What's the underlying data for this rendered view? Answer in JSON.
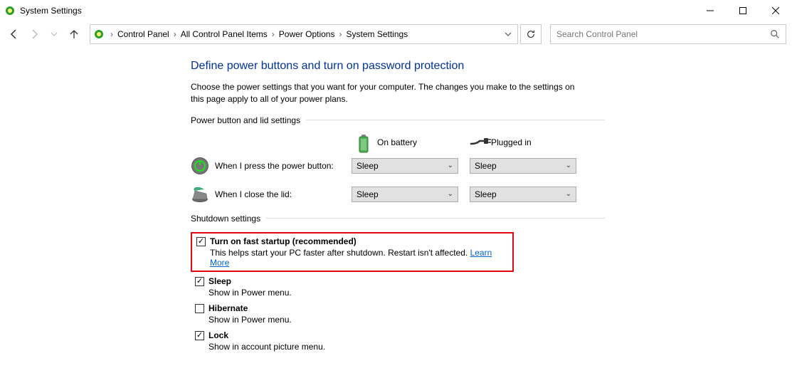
{
  "titlebar": {
    "title": "System Settings"
  },
  "breadcrumb": {
    "items": [
      "Control Panel",
      "All Control Panel Items",
      "Power Options",
      "System Settings"
    ]
  },
  "search": {
    "placeholder": "Search Control Panel"
  },
  "page": {
    "title": "Define power buttons and turn on password protection",
    "description": "Choose the power settings that you want for your computer. The changes you make to the settings on this page apply to all of your power plans."
  },
  "section1": {
    "title": "Power button and lid settings",
    "col_battery": "On battery",
    "col_plugged": "Plugged in",
    "rows": [
      {
        "label": "When I press the power button:",
        "battery": "Sleep",
        "plugged": "Sleep"
      },
      {
        "label": "When I close the lid:",
        "battery": "Sleep",
        "plugged": "Sleep"
      }
    ]
  },
  "section2": {
    "title": "Shutdown settings",
    "items": [
      {
        "label": "Turn on fast startup (recommended)",
        "desc_prefix": "This helps start your PC faster after shutdown. Restart isn't affected. ",
        "link": "Learn More",
        "checked": true,
        "highlight": true
      },
      {
        "label": "Sleep",
        "desc": "Show in Power menu.",
        "checked": true
      },
      {
        "label": "Hibernate",
        "desc": "Show in Power menu.",
        "checked": false
      },
      {
        "label": "Lock",
        "desc": "Show in account picture menu.",
        "checked": true
      }
    ]
  }
}
